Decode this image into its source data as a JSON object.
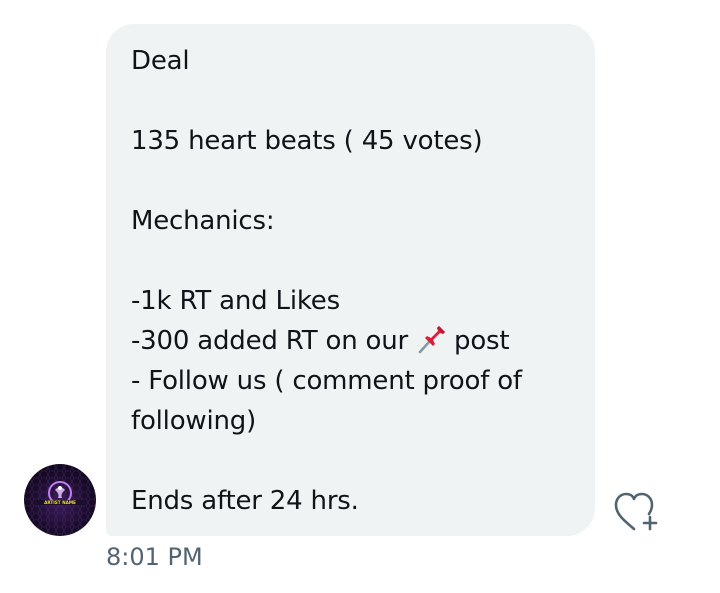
{
  "message": {
    "lines": [
      "Deal",
      "",
      "135 heart beats ( 45 votes)",
      "",
      "Mechanics:",
      "",
      "-1k RT and Likes",
      "-300 added RT on our",
      "post",
      "- Follow us ( comment proof of",
      "following)",
      "",
      "Ends after 24 hrs."
    ],
    "inline_icon": "pushpin-icon"
  },
  "sender": {
    "avatar_text": "ARTIST NAME"
  },
  "react_icon": "heart-plus-icon",
  "timestamp": "8:01 PM",
  "colors": {
    "bubble": "#eff3f4",
    "text": "#0f1419",
    "timestamp": "#536471",
    "pin": "#d91e3c"
  }
}
